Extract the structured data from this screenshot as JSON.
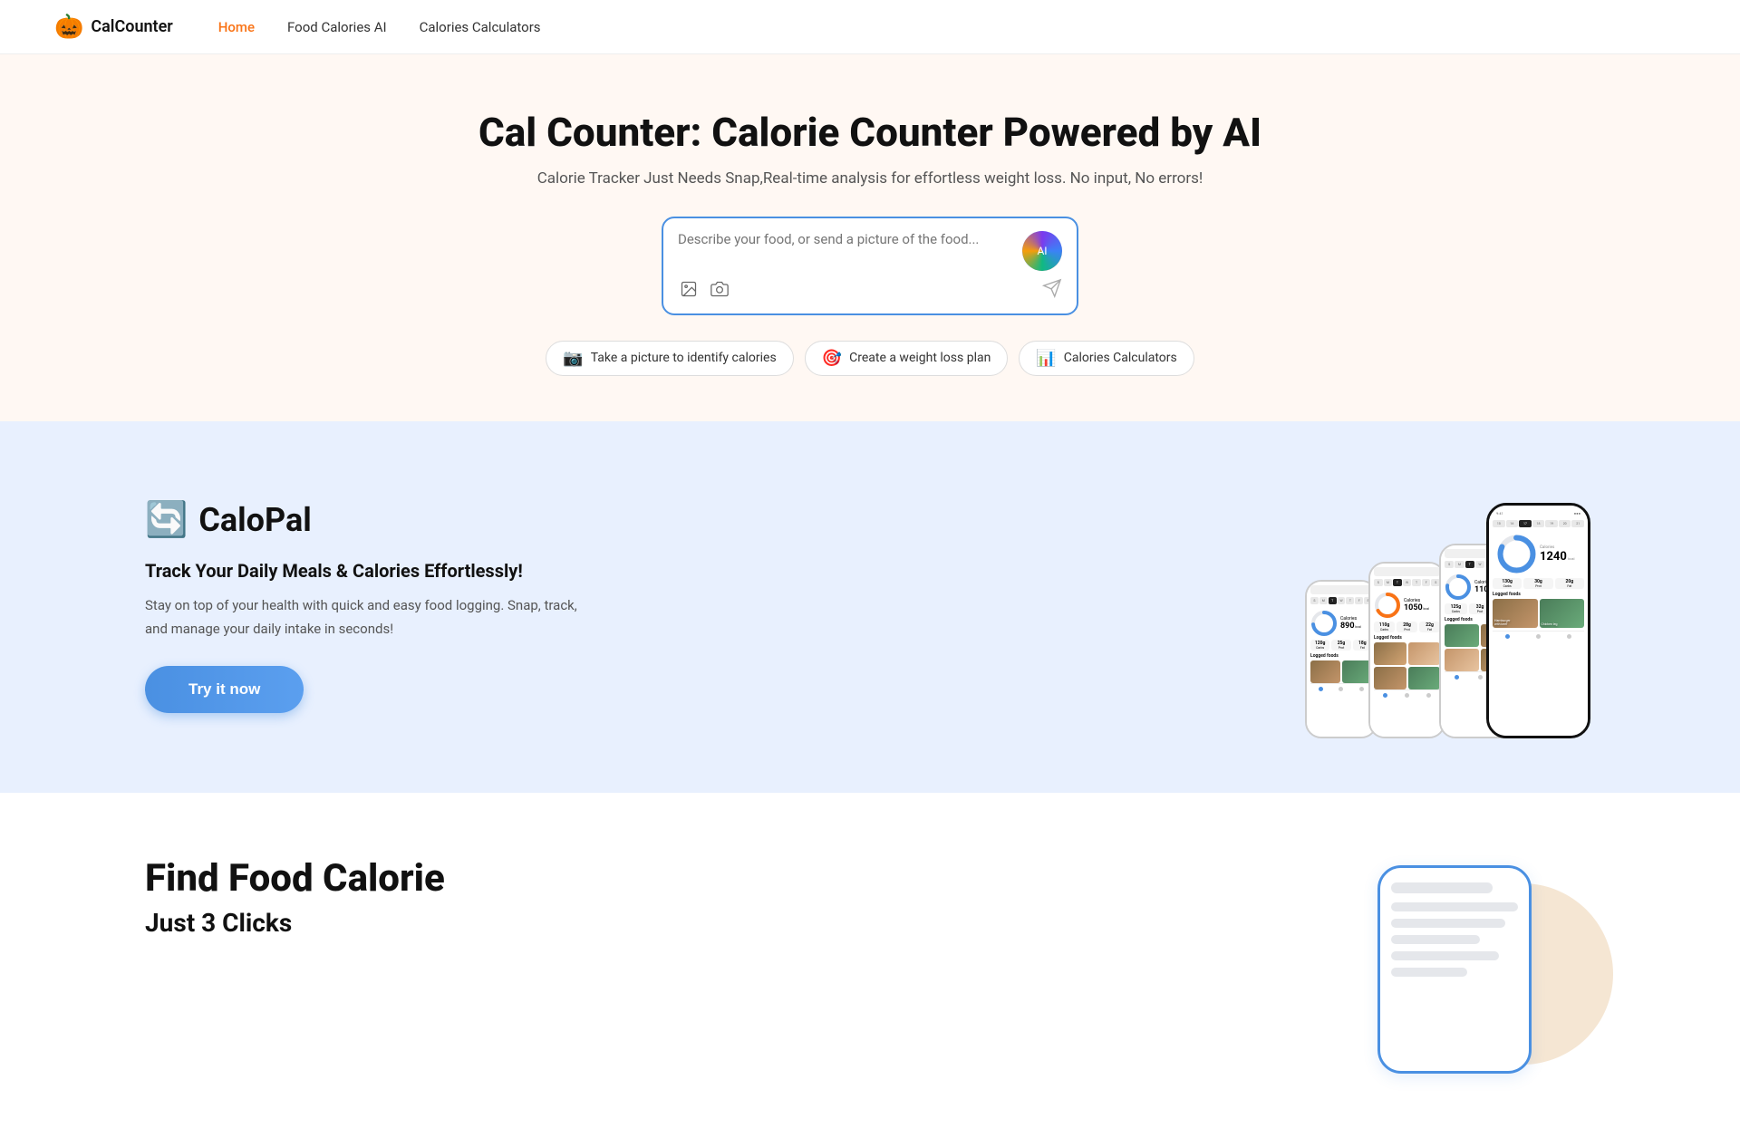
{
  "nav": {
    "logo_icon": "🎃",
    "logo_text": "CalCounter",
    "links": [
      {
        "id": "home",
        "label": "Home",
        "active": true
      },
      {
        "id": "food-calories-ai",
        "label": "Food Calories AI",
        "active": false
      },
      {
        "id": "calories-calculators",
        "label": "Calories Calculators",
        "active": false
      }
    ]
  },
  "hero": {
    "title": "Cal Counter: Calorie Counter Powered by AI",
    "subtitle": "Calorie Tracker Just Needs Snap,Real-time analysis for effortless weight loss. No input, No errors!",
    "search_placeholder": "Describe your food, or send a picture of the food...",
    "pills": [
      {
        "id": "take-picture",
        "emoji": "📷",
        "label": "Take a picture to identify calories"
      },
      {
        "id": "weight-loss",
        "emoji": "🎯",
        "label": "Create a weight loss plan"
      },
      {
        "id": "calculators",
        "emoji": "📊",
        "label": "Calories Calculators"
      }
    ]
  },
  "calopal": {
    "brand_icon": "🔄",
    "brand_name": "CaloPal",
    "heading": "Track Your Daily Meals & Calories Effortlessly!",
    "description": "Stay on top of your health with quick and easy food logging. Snap, track, and manage your daily intake in seconds!",
    "cta_label": "Try it now"
  },
  "phone_ui": {
    "calories": "1240",
    "calories_unit": "kcal",
    "carbs": "130g",
    "protein": "30g",
    "fat": "20g",
    "logged_label": "Logged foods",
    "food_items": [
      {
        "name": "Hamburger with beef",
        "cals": "600 kcal"
      },
      {
        "name": "Chicken leg",
        "cals": "250 kcal"
      }
    ],
    "calendar": [
      "S",
      "M",
      "T",
      "W",
      "T",
      "F",
      "S"
    ],
    "cal_numbers": [
      "15",
      "16",
      "17",
      "18",
      "19",
      "20",
      "21"
    ],
    "active_day": "17"
  },
  "bottom": {
    "title": "Find Food Calorie",
    "subtitle": "Just 3 Clicks"
  }
}
